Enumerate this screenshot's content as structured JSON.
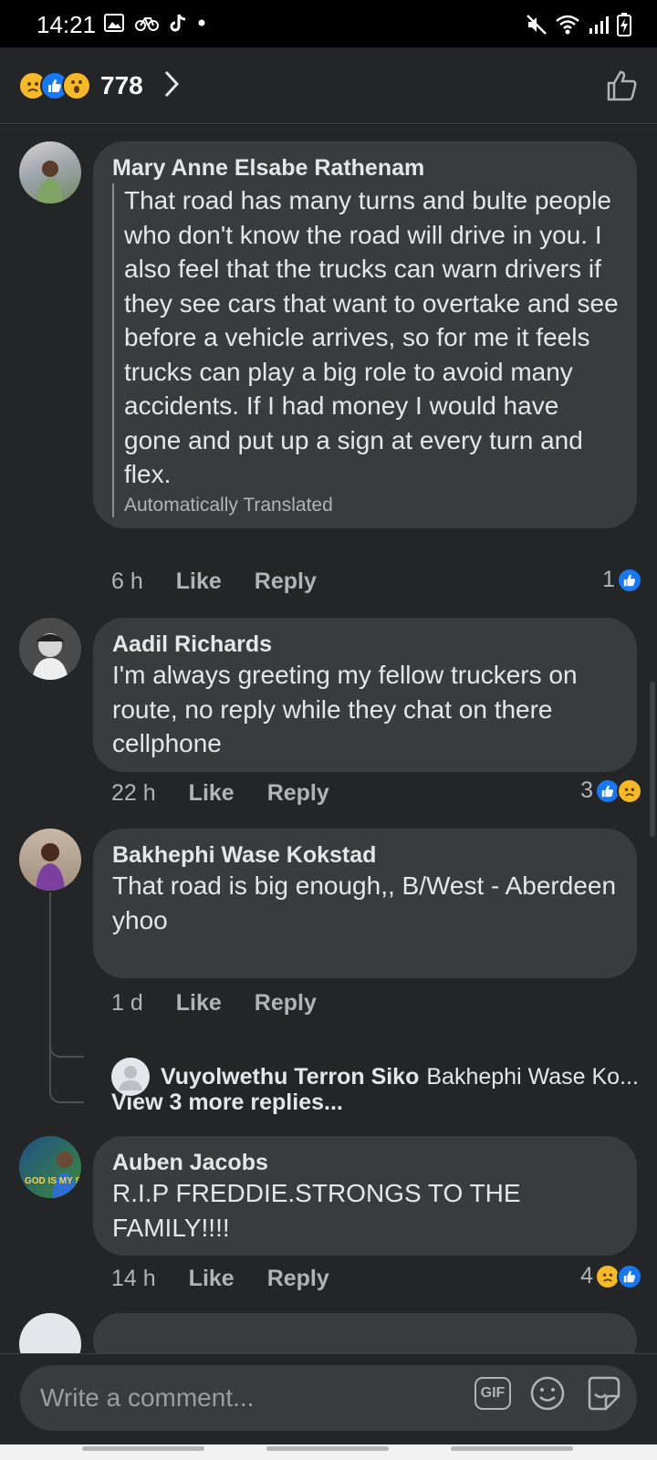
{
  "status_bar": {
    "time": "14:21"
  },
  "reactions_header": {
    "count": "778"
  },
  "comments": [
    {
      "author": "Mary Anne Elsabe Rathenam",
      "text": "That road has many turns and bulte people who don't know the road will drive in you. I also feel that the trucks can warn drivers if they see cars that want to overtake and see before a vehicle arrives, so for me it feels trucks can play a big role to avoid many accidents. If I had money I would have gone and put up a sign at every turn and flex.",
      "note": "Automatically Translated",
      "age": "6 h",
      "like": "Like",
      "reply": "Reply",
      "reaction_count": "1"
    },
    {
      "author": "Aadil Richards",
      "text": "I'm always greeting my fellow truckers on route, no reply while they chat on there cellphone",
      "age": "22 h",
      "like": "Like",
      "reply": "Reply",
      "reaction_count": "3"
    },
    {
      "author": "Bakhephi Wase Kokstad",
      "text": "That road is big enough,, B/West - Aberdeen yhoo",
      "age": "1 d",
      "like": "Like",
      "reply": "Reply",
      "replies": {
        "preview_author": "Vuyolwethu Terron Siko",
        "preview_text": "Bakhephi Wase Ko...",
        "view_more": "View 3 more replies..."
      }
    },
    {
      "author": "Auben Jacobs",
      "text": "R.I.P FREDDIE.STRONGS TO THE FAMILY!!!!",
      "avatar_text": "GOD IS MY S",
      "age": "14 h",
      "like": "Like",
      "reply": "Reply",
      "reaction_count": "4"
    }
  ],
  "composer": {
    "placeholder": "Write a comment...",
    "gif_label": "GIF"
  },
  "colors": {
    "like_blue": "#1877f2",
    "sad_yellow": "#f7b928",
    "bubble": "#3a3b3c",
    "background": "#242526"
  }
}
